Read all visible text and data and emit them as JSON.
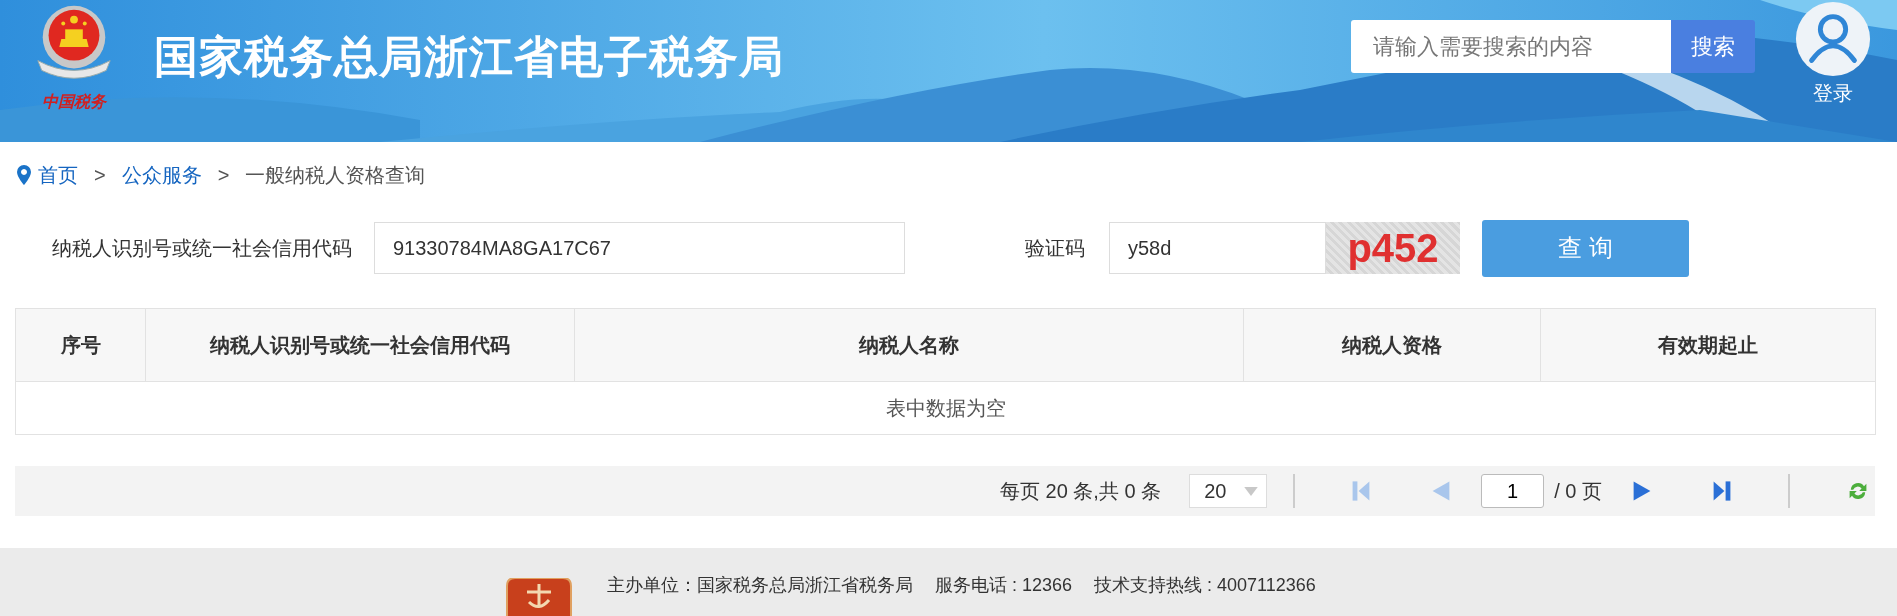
{
  "header": {
    "logo_text": "中国税务",
    "title": "国家税务总局浙江省电子税务局",
    "search": {
      "placeholder": "请输入需要搜索的内容",
      "button": "搜索"
    },
    "login": "登录"
  },
  "breadcrumb": [
    {
      "label": "首页",
      "kind": "link"
    },
    {
      "label": ">",
      "kind": "separator"
    },
    {
      "label": "公众服务",
      "kind": "link"
    },
    {
      "label": ">",
      "kind": "separator"
    },
    {
      "label": "一般纳税人资格查询",
      "kind": "current"
    }
  ],
  "form": {
    "taxpayer_id": {
      "label": "纳税人识别号或统一社会信用代码",
      "value": "91330784MA8GA17C67"
    },
    "captcha": {
      "label": "验证码",
      "value": "y58d",
      "image_text": "p452"
    },
    "button": "查 询"
  },
  "table": {
    "columns": [
      "序号",
      "纳税人识别号或统一社会信用代码",
      "纳税人名称",
      "纳税人资格",
      "有效期起止"
    ],
    "empty_message": "表中数据为空"
  },
  "pagination": {
    "summary": "每页 20 条,共 0 条",
    "page_size": "20",
    "page": "1",
    "total_pages": "/ 0 页",
    "nav": [
      {
        "kind": "first",
        "disabled": true
      },
      {
        "kind": "prev",
        "disabled": true
      },
      {
        "kind": "next",
        "disabled": false
      },
      {
        "kind": "last",
        "disabled": false
      }
    ]
  },
  "footer": [
    "主办单位：国家税务总局浙江省税务局",
    "服务电话 : 12366",
    "技术支持热线 : 4007112366"
  ]
}
